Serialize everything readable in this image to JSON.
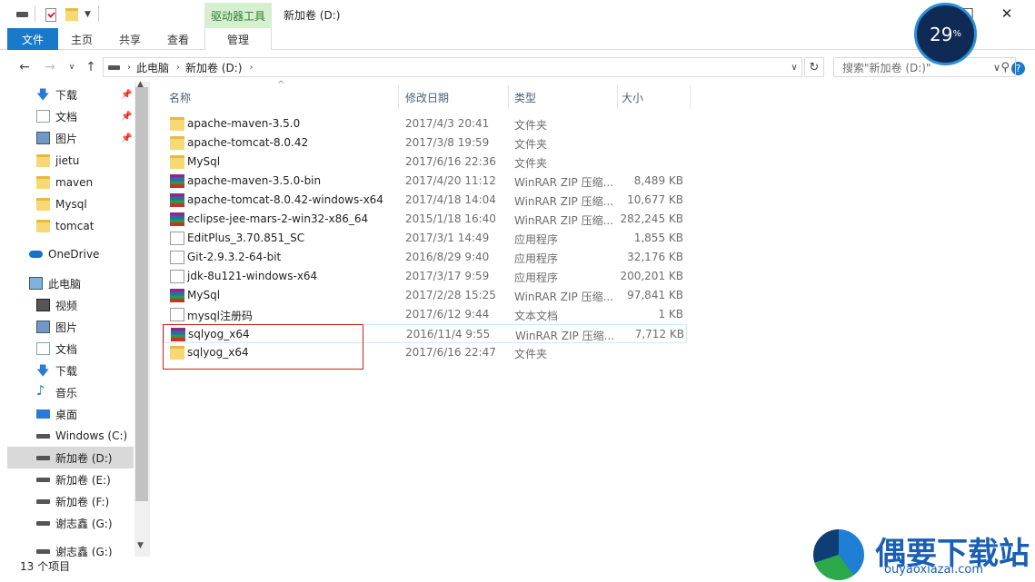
{
  "window": {
    "title": "新加卷 (D:)",
    "context_group": "驱动器工具",
    "minimize": "—",
    "maximize": "☐",
    "close": "✕"
  },
  "ribbon": {
    "tabs": [
      "文件",
      "主页",
      "共享",
      "查看",
      "管理"
    ]
  },
  "address": {
    "segments": [
      "此电脑",
      "新加卷 (D:)"
    ],
    "search_placeholder": "搜索\"新加卷 (D:)\""
  },
  "nav": {
    "items": [
      {
        "label": "下载",
        "icon": "download-icon",
        "pinned": true
      },
      {
        "label": "文档",
        "icon": "document-icon",
        "pinned": true
      },
      {
        "label": "图片",
        "icon": "picture-icon",
        "pinned": true
      },
      {
        "label": "jietu",
        "icon": "folder-icon",
        "pinned": false
      },
      {
        "label": "maven",
        "icon": "folder-icon",
        "pinned": false
      },
      {
        "label": "Mysql",
        "icon": "folder-icon",
        "pinned": false
      },
      {
        "label": "tomcat",
        "icon": "folder-icon",
        "pinned": false
      },
      {
        "label": "OneDrive",
        "icon": "cloud-icon",
        "pinned": false
      },
      {
        "label": "此电脑",
        "icon": "computer-icon",
        "pinned": false
      },
      {
        "label": "视频",
        "icon": "video-icon",
        "pinned": false
      },
      {
        "label": "图片",
        "icon": "picture-icon",
        "pinned": false
      },
      {
        "label": "文档",
        "icon": "document-icon",
        "pinned": false
      },
      {
        "label": "下载",
        "icon": "download-icon",
        "pinned": false
      },
      {
        "label": "音乐",
        "icon": "music-icon",
        "pinned": false
      },
      {
        "label": "桌面",
        "icon": "desktop-icon",
        "pinned": false
      },
      {
        "label": "Windows (C:)",
        "icon": "drive-icon",
        "pinned": false
      },
      {
        "label": "新加卷 (D:)",
        "icon": "drive-icon",
        "pinned": false,
        "selected": true
      },
      {
        "label": "新加卷 (E:)",
        "icon": "drive-icon",
        "pinned": false
      },
      {
        "label": "新加卷 (F:)",
        "icon": "drive-icon",
        "pinned": false
      },
      {
        "label": "谢志鑫 (G:)",
        "icon": "drive-icon",
        "pinned": false
      },
      {
        "label": "谢志鑫 (G:)",
        "icon": "drive-icon",
        "pinned": false
      }
    ]
  },
  "columns": [
    "名称",
    "修改日期",
    "类型",
    "大小"
  ],
  "files": [
    {
      "name": "apache-maven-3.5.0",
      "date": "2017/4/3 20:41",
      "type": "文件夹",
      "size": "",
      "icon": "folder-icon"
    },
    {
      "name": "apache-tomcat-8.0.42",
      "date": "2017/3/8 19:59",
      "type": "文件夹",
      "size": "",
      "icon": "folder-icon"
    },
    {
      "name": "MySql",
      "date": "2017/6/16 22:36",
      "type": "文件夹",
      "size": "",
      "icon": "folder-icon"
    },
    {
      "name": "apache-maven-3.5.0-bin",
      "date": "2017/4/20 11:12",
      "type": "WinRAR ZIP 压缩...",
      "size": "8,489 KB",
      "icon": "rar-icon"
    },
    {
      "name": "apache-tomcat-8.0.42-windows-x64",
      "date": "2017/4/18 14:04",
      "type": "WinRAR ZIP 压缩...",
      "size": "10,677 KB",
      "icon": "rar-icon"
    },
    {
      "name": "eclipse-jee-mars-2-win32-x86_64",
      "date": "2015/1/18 16:40",
      "type": "WinRAR ZIP 压缩...",
      "size": "282,245 KB",
      "icon": "rar-icon"
    },
    {
      "name": "EditPlus_3.70.851_SC",
      "date": "2017/3/1 14:49",
      "type": "应用程序",
      "size": "1,855 KB",
      "icon": "app-icon"
    },
    {
      "name": "Git-2.9.3.2-64-bit",
      "date": "2016/8/29 9:40",
      "type": "应用程序",
      "size": "32,176 KB",
      "icon": "app-icon"
    },
    {
      "name": "jdk-8u121-windows-x64",
      "date": "2017/3/17 9:59",
      "type": "应用程序",
      "size": "200,201 KB",
      "icon": "app-icon"
    },
    {
      "name": "MySql",
      "date": "2017/2/28 15:25",
      "type": "WinRAR ZIP 压缩...",
      "size": "97,841 KB",
      "icon": "rar-icon"
    },
    {
      "name": "mysql注册码",
      "date": "2017/6/12 9:44",
      "type": "文本文档",
      "size": "1 KB",
      "icon": "text-file-icon"
    },
    {
      "name": "sqlyog_x64",
      "date": "2016/11/4 9:55",
      "type": "WinRAR ZIP 压缩...",
      "size": "7,712 KB",
      "icon": "rar-icon"
    },
    {
      "name": "sqlyog_x64",
      "date": "2017/6/16 22:47",
      "type": "文件夹",
      "size": "",
      "icon": "folder-icon"
    }
  ],
  "status": {
    "count": "13 个项目"
  },
  "overlay": {
    "percent": "29",
    "unit": "%"
  },
  "watermark": {
    "title": "偶要下载站",
    "url": "ouyaoxiazai.com"
  },
  "colors": {
    "file_tab": "#1979ca",
    "context_tab": "#d6efd0",
    "highlight_box": "#d01c1c"
  }
}
